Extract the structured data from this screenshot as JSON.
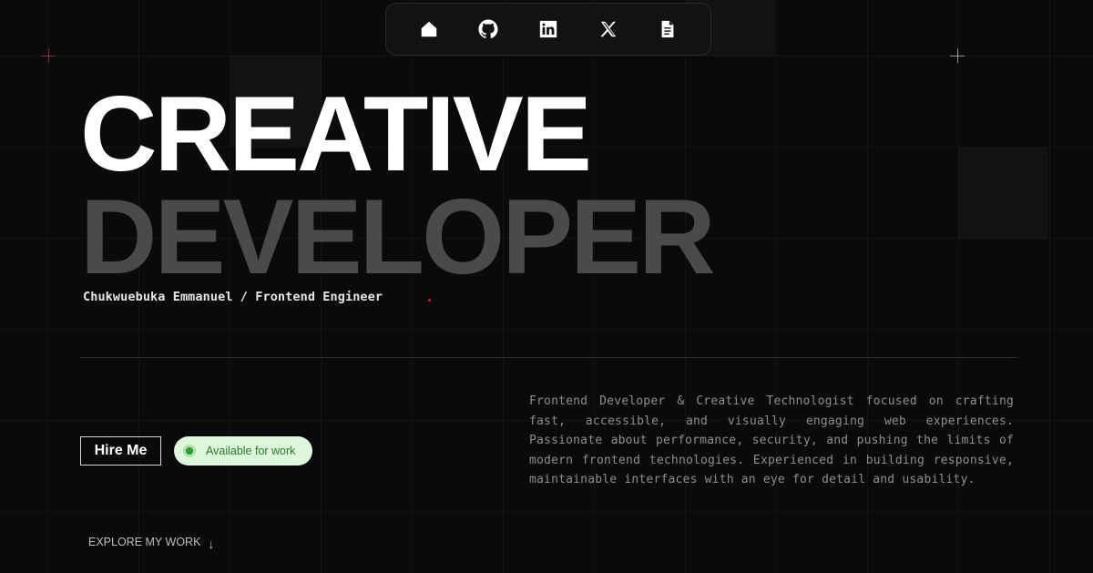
{
  "nav": {
    "items": [
      {
        "icon": "home-icon",
        "label": "Home"
      },
      {
        "icon": "github-icon",
        "label": "GitHub"
      },
      {
        "icon": "linkedin-icon",
        "label": "LinkedIn"
      },
      {
        "icon": "x-icon",
        "label": "X"
      },
      {
        "icon": "resume-icon",
        "label": "Resume"
      }
    ]
  },
  "hero": {
    "line1": "CREATIVE",
    "line2": "DEVELOPER",
    "subtitle": "Chukwuebuka Emmanuel / Frontend Engineer"
  },
  "actions": {
    "hire_label": "Hire Me",
    "status_label": "Available for work"
  },
  "bio": {
    "text": "Frontend Developer & Creative Technologist focused on crafting fast, accessible, and visually engaging web experiences. Passionate about performance, security, and pushing the limits of modern frontend technologies. Experienced in building responsive, maintainable interfaces with an eye for detail and usability."
  },
  "explore": {
    "label": "EXPLORE MY WORK",
    "arrow": "↓"
  },
  "colors": {
    "background": "#0a0a0c",
    "headline_primary": "#ffffff",
    "headline_secondary": "#4a4a4a",
    "status_bg": "#dcf7dc",
    "status_text": "#2a7a28",
    "status_dot": "#2aa52a",
    "accent_dot": "#e02020"
  }
}
